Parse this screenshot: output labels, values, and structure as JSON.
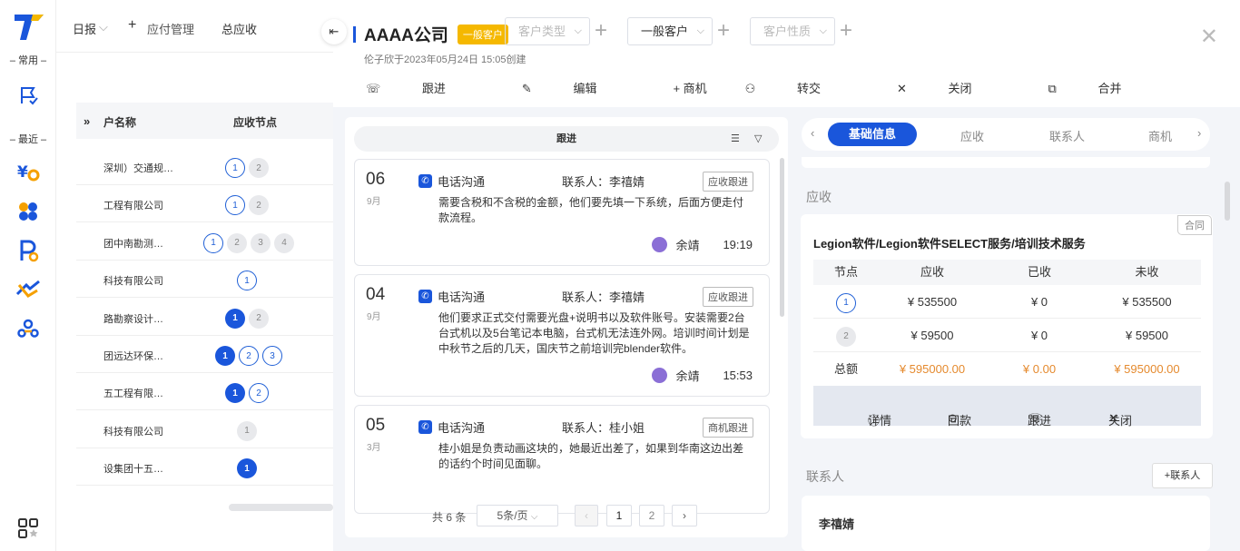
{
  "rail": {
    "label_common": "– 常用 –",
    "label_recent": "– 最近 –",
    "colors": {
      "logo": "#1a56db",
      "logo_accent": "#f5b800"
    }
  },
  "background": {
    "nav": {
      "report": "日报",
      "add": "应付管理",
      "total": "总应收"
    },
    "table": {
      "col_customer": "户名称",
      "col_nodes": "应收节点",
      "rows": [
        {
          "name": "深圳）交通规…",
          "nodes": [
            "1",
            "2"
          ]
        },
        {
          "name": "工程有限公司",
          "nodes": [
            "1",
            "2"
          ]
        },
        {
          "name": "团中南勘测…",
          "nodes": [
            "1",
            "2",
            "3",
            "4"
          ]
        },
        {
          "name": "科技有限公司",
          "nodes": [
            "1"
          ]
        },
        {
          "name": "路勘察设计…",
          "nodes": [
            "1",
            "2"
          ]
        },
        {
          "name": "团远达环保…",
          "nodes": [
            "1",
            "2",
            "3"
          ]
        },
        {
          "name": "五工程有限…",
          "nodes": [
            "1",
            "2"
          ]
        },
        {
          "name": "科技有限公司",
          "nodes": [
            "1"
          ]
        },
        {
          "name": "设集团十五…",
          "nodes": [
            "1"
          ]
        }
      ]
    }
  },
  "panel": {
    "title": "AAAA公司",
    "badge": "一般客户",
    "selects": {
      "customer_type": "客户类型",
      "level": "一般客户",
      "nature": "客户性质"
    },
    "subtitle": "伦子欣于2023年05月24日 15:05创建",
    "actions": {
      "follow": "跟进",
      "edit": "编辑",
      "opportunity": "+ 商机",
      "transfer": "转交",
      "close": "关闭",
      "merge": "合并"
    },
    "followups": {
      "header": "跟进",
      "items": [
        {
          "day": "06",
          "month": "9月",
          "channel": "电话沟通",
          "contact": "联系人：李禧婧",
          "tag": "应收跟进",
          "body": "需要含税和不含税的金额，他们要先填一下系统，后面方便走付款流程。",
          "user": "余靖",
          "time": "19:19"
        },
        {
          "day": "04",
          "month": "9月",
          "channel": "电话沟通",
          "contact": "联系人：李禧婧",
          "tag": "应收跟进",
          "body": "他们要求正式交付需要光盘+说明书以及软件账号。安装需要2台台式机以及5台笔记本电脑，台式机无法连外网。培训时间计划是中秋节之后的几天，国庆节之前培训完blender软件。",
          "user": "余靖",
          "time": "15:53"
        },
        {
          "day": "05",
          "month": "3月",
          "channel": "电话沟通",
          "contact": "联系人：桂小姐",
          "tag": "商机跟进",
          "body": "桂小姐是负责动画这块的，她最近出差了，如果到华南这边出差的话约个时间见面聊。",
          "user": "",
          "time": ""
        }
      ],
      "pager": {
        "total": "共 6 条",
        "page_size": "5条/页",
        "pages": [
          "1",
          "2"
        ]
      }
    },
    "tabs": [
      "基础信息",
      "应收",
      "联系人",
      "商机"
    ],
    "receivable": {
      "section": "应收",
      "contract_tag": "合同",
      "product": "Legion软件/Legion软件SELECT服务/培训技术服务",
      "columns": [
        "节点",
        "应收",
        "已收",
        "未收"
      ],
      "rows": [
        {
          "node": "1",
          "due": "¥ 535500",
          "received": "¥ 0",
          "unpaid": "¥ 535500"
        },
        {
          "node": "2",
          "due": "¥ 59500",
          "received": "¥ 0",
          "unpaid": "¥ 59500"
        }
      ],
      "total": {
        "label": "总额",
        "due": "¥ 595000.00",
        "received": "¥ 0.00",
        "unpaid": "¥ 595000.00"
      },
      "actions": {
        "detail": "详情",
        "refund": "回款",
        "follow": "跟进",
        "close": "关闭"
      }
    },
    "contacts": {
      "section": "联系人",
      "add": "+联系人",
      "first": "李禧婧"
    }
  }
}
